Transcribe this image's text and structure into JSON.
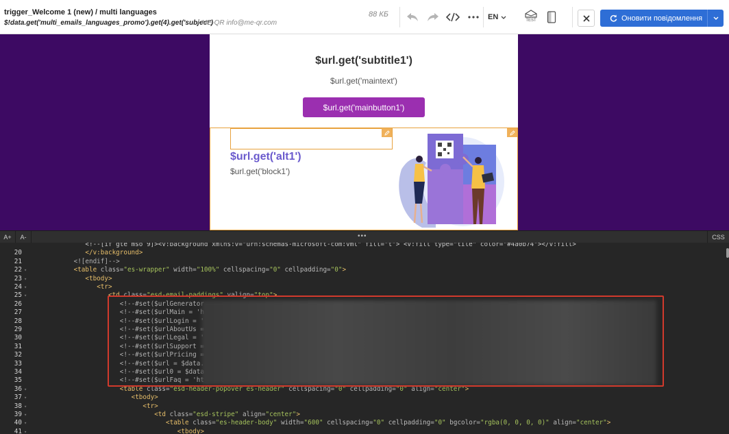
{
  "header": {
    "title": "trigger_Welcome 1 (new) / multi languages",
    "subject": "$!data.get('multi_emails_languages_promo').get(4).get('subject')",
    "sender": "• ME-QR info@me-qr.com",
    "size": "88 КБ",
    "language": "EN",
    "test_label": "TEST",
    "refresh_label": "Оновити повідомлення"
  },
  "email": {
    "subtitle": "$url.get('subtitle1')",
    "maintext": "$url.get('maintext')",
    "mainbutton": "$url.get('mainbutton1')",
    "alt": "$url.get('alt1')",
    "block": "$url.get('block1')"
  },
  "editor": {
    "font_increase": "A+",
    "font_decrease": "A-",
    "css_label": "CSS",
    "dots": "•••",
    "lines": [
      {
        "n": "",
        "indent": 14,
        "segs": [
          [
            "t-plain",
            "<!--[if gte mso 9]><v:background xmlns:v=\"urn:schemas-microsoft-com:vml\" fill=\"t\"> <v:fill type=\"tile\" color=\"#4a0b74\"></v:fill>"
          ]
        ]
      },
      {
        "n": "20",
        "indent": 14,
        "segs": [
          [
            "t-tag",
            "</v:background>"
          ]
        ]
      },
      {
        "n": "21",
        "indent": 11,
        "segs": [
          [
            "t-cmt",
            "<![endif]-->"
          ]
        ]
      },
      {
        "n": "22",
        "indent": 11,
        "segs": [
          [
            "t-tag",
            "<table "
          ],
          [
            "t-attr",
            "class="
          ],
          [
            "t-str",
            "\"es-wrapper\" "
          ],
          [
            "t-attr",
            "width="
          ],
          [
            "t-str",
            "\"100%\" "
          ],
          [
            "t-attr",
            "cellspacing="
          ],
          [
            "t-str",
            "\"0\" "
          ],
          [
            "t-attr",
            "cellpadding="
          ],
          [
            "t-str",
            "\"0\""
          ],
          [
            "t-tag",
            ">"
          ]
        ]
      },
      {
        "n": "23",
        "indent": 14,
        "segs": [
          [
            "t-tag",
            "<tbody>"
          ]
        ]
      },
      {
        "n": "24",
        "indent": 17,
        "segs": [
          [
            "t-tag",
            "<tr>"
          ]
        ]
      },
      {
        "n": "25",
        "indent": 20,
        "segs": [
          [
            "t-tag",
            "<td "
          ],
          [
            "t-attr",
            "class="
          ],
          [
            "t-str",
            "\"esd-email-paddings\" "
          ],
          [
            "t-attr",
            "valign="
          ],
          [
            "t-str",
            "\"top\""
          ],
          [
            "t-tag",
            ">"
          ]
        ]
      },
      {
        "n": "26",
        "indent": 23,
        "segs": [
          [
            "t-cmt",
            "<!--#set($urlGenerator"
          ]
        ]
      },
      {
        "n": "27",
        "indent": 23,
        "segs": [
          [
            "t-cmt",
            "<!--#set($urlMain = 'h"
          ]
        ]
      },
      {
        "n": "28",
        "indent": 23,
        "segs": [
          [
            "t-cmt",
            "<!--#set($urlLogin = '"
          ]
        ]
      },
      {
        "n": "29",
        "indent": 23,
        "segs": [
          [
            "t-cmt",
            "<!--#set($urlAboutUs ="
          ]
        ]
      },
      {
        "n": "30",
        "indent": 23,
        "segs": [
          [
            "t-cmt",
            "<!--#set($urlLegal = '"
          ]
        ]
      },
      {
        "n": "31",
        "indent": 23,
        "segs": [
          [
            "t-cmt",
            "<!--#set($urlSupport ="
          ]
        ]
      },
      {
        "n": "32",
        "indent": 23,
        "segs": [
          [
            "t-cmt",
            "<!--#set($urlPricing ="
          ]
        ]
      },
      {
        "n": "33",
        "indent": 23,
        "segs": [
          [
            "t-cmt",
            "<!--#set($url = $data."
          ]
        ]
      },
      {
        "n": "34",
        "indent": 23,
        "segs": [
          [
            "t-cmt",
            "<!--#set($url0 = $data"
          ]
        ]
      },
      {
        "n": "35",
        "indent": 23,
        "segs": [
          [
            "t-cmt",
            "<!--#set($urlFaq = 'ht"
          ]
        ]
      },
      {
        "n": "36",
        "indent": 23,
        "segs": [
          [
            "t-tag",
            "<table "
          ],
          [
            "t-attr",
            "class="
          ],
          [
            "t-str",
            "\"esd-header-popover es-header\" "
          ],
          [
            "t-attr",
            "cellspacing="
          ],
          [
            "t-str",
            "\"0\" "
          ],
          [
            "t-attr",
            "cellpadding="
          ],
          [
            "t-str",
            "\"0\" "
          ],
          [
            "t-attr",
            "align="
          ],
          [
            "t-str",
            "\"center\""
          ],
          [
            "t-tag",
            ">"
          ]
        ]
      },
      {
        "n": "37",
        "indent": 26,
        "segs": [
          [
            "t-tag",
            "<tbody>"
          ]
        ]
      },
      {
        "n": "38",
        "indent": 29,
        "segs": [
          [
            "t-tag",
            "<tr>"
          ]
        ]
      },
      {
        "n": "39",
        "indent": 32,
        "segs": [
          [
            "t-tag",
            "<td "
          ],
          [
            "t-attr",
            "class="
          ],
          [
            "t-str",
            "\"esd-stripe\" "
          ],
          [
            "t-attr",
            "align="
          ],
          [
            "t-str",
            "\"center\""
          ],
          [
            "t-tag",
            ">"
          ]
        ]
      },
      {
        "n": "40",
        "indent": 35,
        "segs": [
          [
            "t-tag",
            "<table "
          ],
          [
            "t-attr",
            "class="
          ],
          [
            "t-str",
            "\"es-header-body\" "
          ],
          [
            "t-attr",
            "width="
          ],
          [
            "t-str",
            "\"600\" "
          ],
          [
            "t-attr",
            "cellspacing="
          ],
          [
            "t-str",
            "\"0\" "
          ],
          [
            "t-attr",
            "cellpadding="
          ],
          [
            "t-str",
            "\"0\" "
          ],
          [
            "t-attr",
            "bgcolor="
          ],
          [
            "t-str",
            "\"rgba(0, 0, 0, 0)\" "
          ],
          [
            "t-attr",
            "align="
          ],
          [
            "t-str",
            "\"center\""
          ],
          [
            "t-tag",
            ">"
          ]
        ]
      },
      {
        "n": "41",
        "indent": 38,
        "segs": [
          [
            "t-tag",
            "<tbody>"
          ]
        ]
      }
    ]
  },
  "colors": {
    "preview_bg": "#3d0a63",
    "accent_button": "#9b2fb0",
    "refresh_button": "#2e6ed6",
    "highlight": "#d23a2c"
  }
}
